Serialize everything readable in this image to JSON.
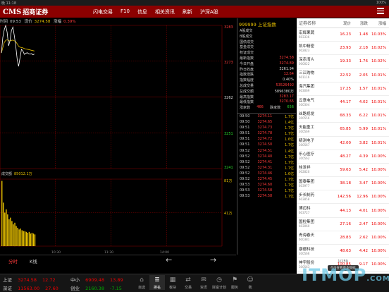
{
  "status": {
    "time": "晚 11:18",
    "battery": "100%"
  },
  "app": {
    "logo_en": "CMS",
    "logo_cn": "招商证券"
  },
  "nav": [
    "闪电交易",
    "F10",
    "信息",
    "相关资讯",
    "刷新",
    "沪深A股"
  ],
  "chart_head": {
    "time_label": "时间",
    "time": "09:53",
    "price_label": "现价",
    "price": "3274.58",
    "change_label": "涨幅",
    "change": "0.39%"
  },
  "axis_labels": {
    "y1": "3283",
    "y2": "3273",
    "y3": "3262",
    "y4": "3251",
    "y5": "3241",
    "vol_label": "成交额",
    "vol_value": "85012.1万",
    "vol1": "81万",
    "vol2": "41万",
    "t1": "10:30",
    "t2": "11:30",
    "t3": "14:00"
  },
  "chart_tabs": {
    "fen": "分时",
    "k": "K线"
  },
  "quote": {
    "title": "999999 上证指数",
    "rows": [
      {
        "k": "A股成交",
        "v": "",
        "c": "w"
      },
      {
        "k": "B股成交",
        "v": "",
        "c": "w"
      },
      {
        "k": "国债成交",
        "v": "",
        "c": "w"
      },
      {
        "k": "基金成交",
        "v": "",
        "c": "w"
      },
      {
        "k": "权证成交",
        "v": "",
        "c": "w"
      },
      {
        "k": "最新指数",
        "v": "3274.58",
        "c": "v"
      },
      {
        "k": "今日开盘",
        "v": "3274.89",
        "c": "v"
      },
      {
        "k": "昨日收盘",
        "v": "3261.94",
        "c": "w"
      },
      {
        "k": "指数涨跌",
        "v": "12.64",
        "c": "v"
      },
      {
        "k": "指数幅度",
        "v": "0.40%",
        "c": "w"
      },
      {
        "k": "总成交量",
        "v": "53526492",
        "c": "v"
      },
      {
        "k": "总成交额",
        "v": "5896380万",
        "c": "w"
      },
      {
        "k": "最高指数",
        "v": "3283.17",
        "c": "v"
      },
      {
        "k": "最低指数",
        "v": "3270.65",
        "c": "v"
      }
    ],
    "updown": {
      "k": "涨家数",
      "up": "466",
      "mid": "跌家数",
      "down": "656"
    },
    "ticks": [
      {
        "t": "09:50",
        "p": "3274.11",
        "v": "1.7亿"
      },
      {
        "t": "09:50",
        "p": "3274.65",
        "v": "1.4亿"
      },
      {
        "t": "09:51",
        "p": "3274.73",
        "v": "1.7亿"
      },
      {
        "t": "09:51",
        "p": "3274.78",
        "v": "1.7亿"
      },
      {
        "t": "09:51",
        "p": "3274.72",
        "v": "1.6亿"
      },
      {
        "t": "09:51",
        "p": "3274.50",
        "v": "1.7亿"
      },
      {
        "t": "09:52",
        "p": "3274.51",
        "v": "1.4亿"
      },
      {
        "t": "09:52",
        "p": "3274.40",
        "v": "1.7亿"
      },
      {
        "t": "09:52",
        "p": "3274.41",
        "v": "1.7亿"
      },
      {
        "t": "09:52",
        "p": "3274.31",
        "v": "1.7亿"
      },
      {
        "t": "09:52",
        "p": "3274.46",
        "v": "1.6亿"
      },
      {
        "t": "09:52",
        "p": "3274.45",
        "v": "1.7亿"
      },
      {
        "t": "09:53",
        "p": "3274.60",
        "v": "1.7亿"
      },
      {
        "t": "09:53",
        "p": "3274.58",
        "v": "1.7亿"
      },
      {
        "t": "09:53",
        "p": "3274.58",
        "v": "1.7亿"
      }
    ]
  },
  "list": {
    "headers": [
      "证券名称",
      "现价",
      "涨跌",
      "涨幅"
    ],
    "rows": [
      {
        "name": "宏辉果蔬",
        "code": "603336",
        "px": "16.23",
        "ch": "1.48",
        "pct": "10.03%",
        "dir": "red"
      },
      {
        "name": "凯中精密",
        "code": "002823",
        "px": "23.93",
        "ch": "2.18",
        "pct": "10.02%",
        "dir": "red"
      },
      {
        "name": "深赤湾Ａ",
        "code": "000022",
        "px": "19.33",
        "ch": "1.76",
        "pct": "10.02%",
        "dir": "red"
      },
      {
        "name": "三江购物",
        "code": "601116",
        "px": "22.52",
        "ch": "2.05",
        "pct": "10.01%",
        "dir": "red"
      },
      {
        "name": "海汽集团",
        "code": "603069",
        "px": "17.25",
        "ch": "1.57",
        "pct": "10.01%",
        "dir": "red"
      },
      {
        "name": "云意电气",
        "code": "300304",
        "px": "44.17",
        "ch": "4.02",
        "pct": "10.01%",
        "dir": "red"
      },
      {
        "name": "丝路视觉",
        "code": "300556",
        "px": "68.33",
        "ch": "6.22",
        "pct": "10.01%",
        "dir": "red"
      },
      {
        "name": "天能重工",
        "code": "300569",
        "px": "65.85",
        "ch": "5.99",
        "pct": "10.01%",
        "dir": "red"
      },
      {
        "name": "精测电子",
        "code": "300567",
        "px": "42.00",
        "ch": "3.82",
        "pct": "10.01%",
        "dir": "red"
      },
      {
        "name": "乐心医疗",
        "code": "300562",
        "px": "48.27",
        "ch": "4.39",
        "pct": "10.00%",
        "dir": "red"
      },
      {
        "name": "桂发祥",
        "code": "002820",
        "px": "59.63",
        "ch": "5.42",
        "pct": "10.00%",
        "dir": "red"
      },
      {
        "name": "国泰集团",
        "code": "603977",
        "px": "38.18",
        "ch": "3.47",
        "pct": "10.00%",
        "dir": "red"
      },
      {
        "name": "步长制药",
        "code": "603858",
        "px": "142.56",
        "ch": "12.96",
        "pct": "10.00%",
        "dir": "red"
      },
      {
        "name": "博迈科",
        "code": "603727",
        "px": "44.13",
        "ch": "4.01",
        "pct": "10.00%",
        "dir": "red"
      },
      {
        "name": "国检集团",
        "code": "603060",
        "px": "27.16",
        "ch": "2.47",
        "pct": "10.00%",
        "dir": "red"
      },
      {
        "name": "青海春天",
        "code": "600381",
        "px": "28.83",
        "ch": "2.62",
        "pct": "10.00%",
        "dir": "red"
      },
      {
        "name": "康德科技",
        "code": "300566",
        "px": "48.63",
        "ch": "4.42",
        "pct": "10.00%",
        "dir": "red"
      },
      {
        "name": "神宇股份",
        "code": "300563",
        "px": "100.85",
        "ch": "9.17",
        "pct": "10.00%",
        "dir": "red"
      }
    ],
    "footer_page": "1/159",
    "footer_tip": "点击查看更多数据"
  },
  "bottom": {
    "sh": {
      "name": "上证",
      "price": "3274.58",
      "change": "12.72"
    },
    "sz": {
      "name": "深证",
      "price": "11563.00",
      "change": "27.60"
    },
    "zx": {
      "name": "中小",
      "price": "6909.48",
      "change": "13.89"
    },
    "cy": {
      "name": "创业",
      "price": "2160.38",
      "change": "-7.15"
    },
    "icons": [
      {
        "glyph": "⌂",
        "label": "自选"
      },
      {
        "glyph": "≣",
        "label": "排名"
      },
      {
        "glyph": "▦",
        "label": "板块"
      },
      {
        "glyph": "⇄",
        "label": "交易"
      },
      {
        "glyph": "✉",
        "label": "资讯"
      },
      {
        "glyph": "◷",
        "label": "财富计划"
      },
      {
        "glyph": "⚑",
        "label": "服务"
      },
      {
        "glyph": "☺",
        "label": "我"
      }
    ]
  },
  "watermark": "ITMOP",
  "watermark_suffix": ".COM",
  "chart_data": {
    "type": "line",
    "x": [
      "09:30",
      "09:31",
      "09:32",
      "09:33",
      "09:34",
      "09:35",
      "09:36",
      "09:37",
      "09:38",
      "09:39",
      "09:40",
      "09:41",
      "09:42",
      "09:43",
      "09:44",
      "09:45",
      "09:46",
      "09:47",
      "09:48",
      "09:49",
      "09:50",
      "09:51",
      "09:52",
      "09:53"
    ],
    "series": [
      {
        "values": [
          3274.9,
          3279.5,
          3281.8,
          3283.0,
          3281.0,
          3277.0,
          3278.5,
          3281.5,
          3282.5,
          3280.0,
          3277.0,
          3273.0,
          3271.0,
          3273.5,
          3276.0,
          3275.5,
          3274.5,
          3274.8,
          3275.0,
          3274.7,
          3274.6,
          3274.7,
          3274.4,
          3274.6
        ]
      },
      {
        "values": [
          3274.9,
          3276.5,
          3278.0,
          3278.6,
          3278.8,
          3278.5,
          3278.4,
          3278.6,
          3278.7,
          3278.5,
          3278.2,
          3277.6,
          3276.9,
          3276.6,
          3276.5,
          3276.4,
          3276.2,
          3276.1,
          3276.0,
          3275.9,
          3275.8,
          3275.7,
          3275.6,
          3275.5
        ]
      }
    ],
    "volume": [
      78,
      52,
      40,
      44,
      38,
      32,
      34,
      30,
      26,
      28,
      24,
      22,
      20,
      21,
      19,
      18,
      18,
      17,
      16,
      17,
      15,
      16,
      15,
      14
    ],
    "ylim": [
      3241,
      3283
    ],
    "y_ticks": [
      3283,
      3273,
      3262,
      3251,
      3241
    ],
    "xlim_minutes": 240
  }
}
